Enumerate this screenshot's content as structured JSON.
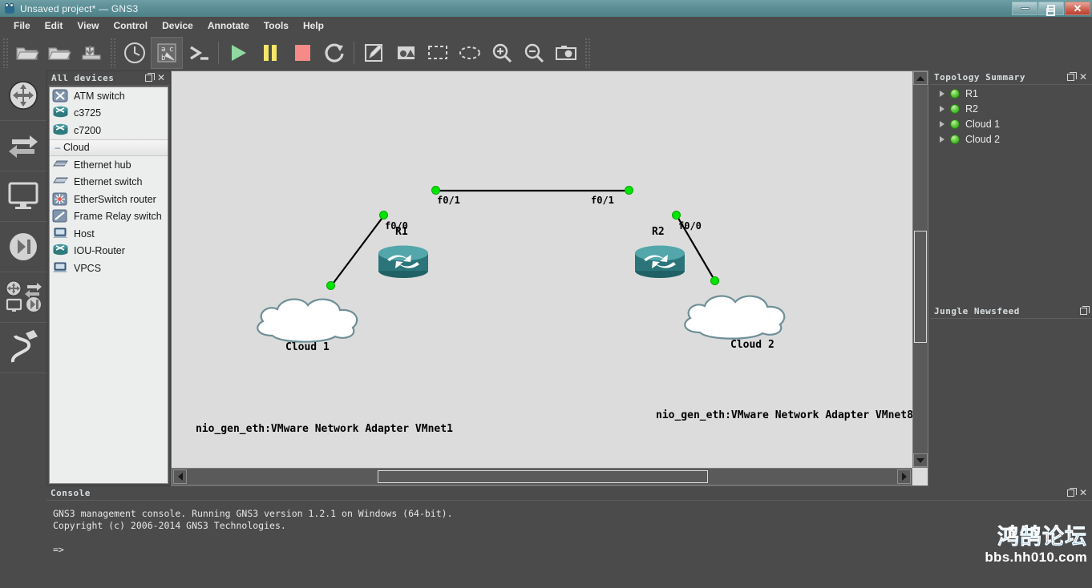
{
  "window": {
    "title": "Unsaved project* — GNS3",
    "app_icon": "gns3-logo-icon",
    "controls": [
      {
        "name": "minimize-button",
        "glyph": "minimize-icon"
      },
      {
        "name": "restore-button",
        "glyph": "restore-icon"
      },
      {
        "name": "close-button",
        "glyph": "close-icon",
        "color": "#b8402f"
      }
    ]
  },
  "menubar": {
    "items": [
      "File",
      "Edit",
      "View",
      "Control",
      "Device",
      "Annotate",
      "Tools",
      "Help"
    ]
  },
  "toolbar": {
    "groups": [
      [
        {
          "name": "new-project-button",
          "icon": "folder-new-icon"
        },
        {
          "name": "open-project-button",
          "icon": "folder-open-icon"
        },
        {
          "name": "save-project-button",
          "icon": "save-icon"
        }
      ],
      [
        {
          "name": "snapshot-button",
          "icon": "clock-icon"
        },
        {
          "name": "show-hide-interface-labels-button",
          "icon": "abc-label-icon",
          "pressed": true
        },
        {
          "name": "console-all-button",
          "icon": "terminal-icon"
        }
      ],
      [
        {
          "name": "start-all-button",
          "icon": "play-icon",
          "color": "#8fd9a0"
        },
        {
          "name": "suspend-all-button",
          "icon": "pause-icon",
          "color": "#f5e66b"
        },
        {
          "name": "stop-all-button",
          "icon": "stop-icon",
          "color": "#f58a86"
        },
        {
          "name": "reload-all-button",
          "icon": "reload-icon"
        }
      ],
      [
        {
          "name": "add-note-button",
          "icon": "note-pencil-icon"
        },
        {
          "name": "insert-image-button",
          "icon": "image-icon"
        },
        {
          "name": "draw-rectangle-button",
          "icon": "rectangle-icon"
        },
        {
          "name": "draw-ellipse-button",
          "icon": "ellipse-icon"
        },
        {
          "name": "zoom-in-button",
          "icon": "zoom-in-icon"
        },
        {
          "name": "zoom-out-button",
          "icon": "zoom-out-icon"
        },
        {
          "name": "screenshot-button",
          "icon": "camera-icon"
        }
      ]
    ]
  },
  "device_bar": {
    "buttons": [
      {
        "name": "routers-button",
        "icon": "router-icon"
      },
      {
        "name": "switches-button",
        "icon": "switch-arrows-icon"
      },
      {
        "name": "end-devices-button",
        "icon": "monitor-icon"
      },
      {
        "name": "security-devices-button",
        "icon": "firewall-icon"
      },
      {
        "name": "all-devices-button",
        "icon": "all-devices-icon"
      },
      {
        "name": "add-link-button",
        "icon": "cable-link-icon"
      }
    ]
  },
  "devices_panel": {
    "title": "All devices",
    "float_icon": "float-icon",
    "close_icon": "close-icon",
    "items": [
      {
        "label": "ATM switch",
        "icon": "atm-switch-icon",
        "selected": false
      },
      {
        "label": "c3725",
        "icon": "router-icon",
        "selected": false
      },
      {
        "label": "c7200",
        "icon": "router-icon",
        "selected": false
      },
      {
        "label": "Cloud",
        "icon": "cloud-dash-icon",
        "selected": true
      },
      {
        "label": "Ethernet hub",
        "icon": "hub-icon",
        "selected": false
      },
      {
        "label": "Ethernet switch",
        "icon": "switch-icon",
        "selected": false
      },
      {
        "label": "EtherSwitch router",
        "icon": "etherswitch-icon",
        "selected": false
      },
      {
        "label": "Frame Relay switch",
        "icon": "frame-relay-icon",
        "selected": false
      },
      {
        "label": "Host",
        "icon": "host-icon",
        "selected": false
      },
      {
        "label": "IOU-Router",
        "icon": "router-icon",
        "selected": false
      },
      {
        "label": "VPCS",
        "icon": "vpcs-icon",
        "selected": false
      }
    ]
  },
  "topology_summary": {
    "title": "Topology Summary",
    "float_icon": "float-icon",
    "close_icon": "close-icon",
    "nodes": [
      {
        "label": "R1",
        "status": "running",
        "status_color": "#5cc42e"
      },
      {
        "label": "R2",
        "status": "running",
        "status_color": "#5cc42e"
      },
      {
        "label": "Cloud 1",
        "status": "running",
        "status_color": "#5cc42e"
      },
      {
        "label": "Cloud 2",
        "status": "running",
        "status_color": "#5cc42e"
      }
    ]
  },
  "newsfeed": {
    "title": "Jungle Newsfeed",
    "float_icon": "float-icon"
  },
  "canvas": {
    "nodes": [
      {
        "name": "R1",
        "label": "R1",
        "type": "router"
      },
      {
        "name": "R2",
        "label": "R2",
        "type": "router"
      },
      {
        "name": "Cloud 1",
        "label": "Cloud 1",
        "type": "cloud",
        "caption": "nio_gen_eth:VMware Network Adapter VMnet1"
      },
      {
        "name": "Cloud 2",
        "label": "Cloud 2",
        "type": "cloud",
        "caption": "nio_gen_eth:VMware Network Adapter VMnet8"
      }
    ],
    "link_labels": {
      "r1_f01": "f0/1",
      "r2_f01": "f0/1",
      "r1_f00": "f0/0",
      "r2_f00": "f0/0"
    }
  },
  "console": {
    "title": "Console",
    "float_icon": "float-icon",
    "close_icon": "close-icon",
    "lines": [
      "GNS3 management console. Running GNS3 version 1.2.1 on Windows (64-bit).",
      "Copyright (c) 2006-2014 GNS3 Technologies.",
      "",
      "=>"
    ]
  },
  "watermark": {
    "cn": "鸿鹄论坛",
    "url": "bbs.hh010.com"
  }
}
